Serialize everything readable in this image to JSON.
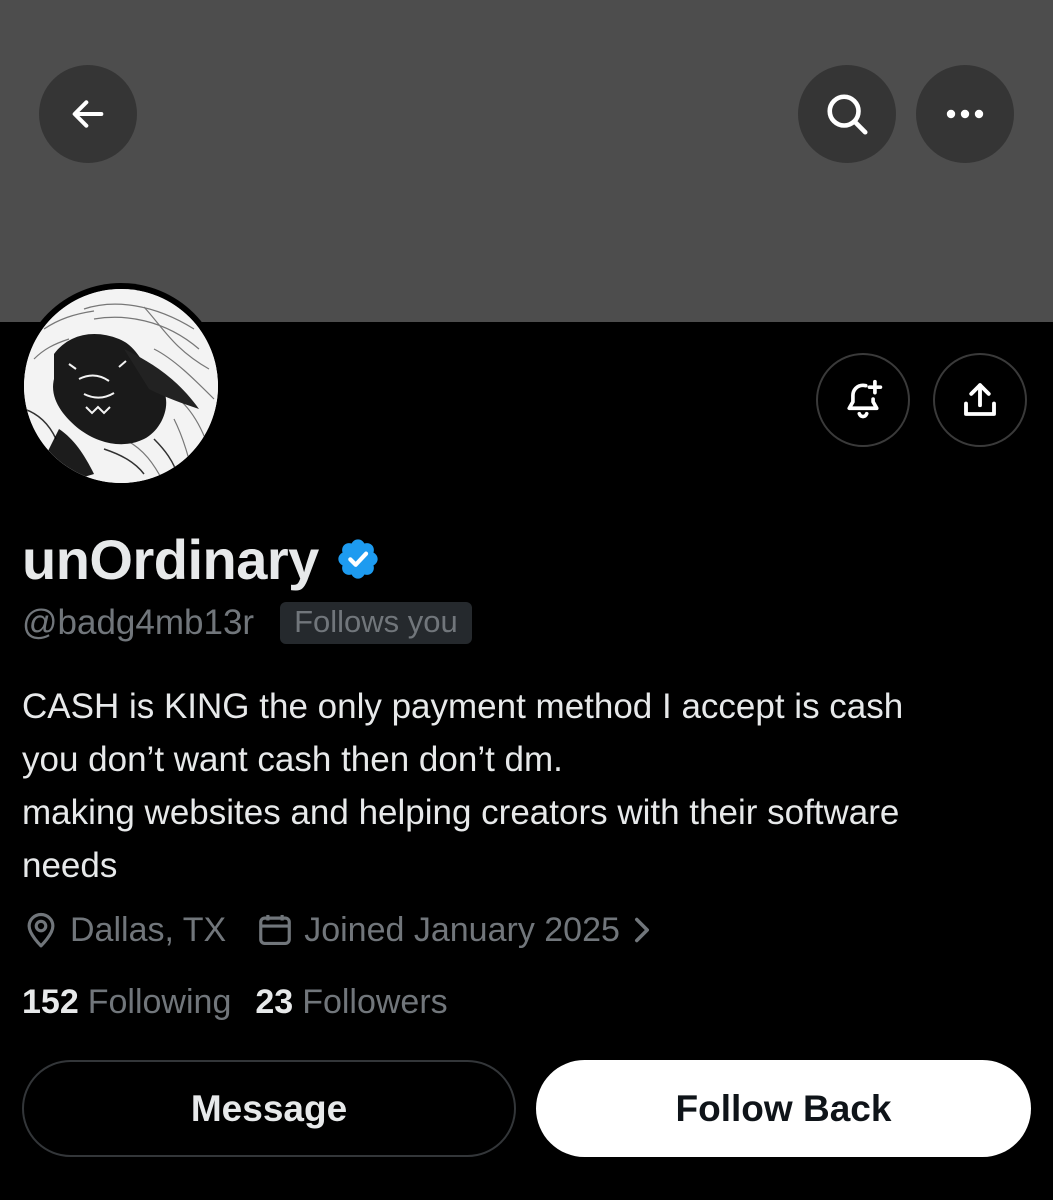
{
  "header": {
    "back_icon": "arrow-left-icon",
    "search_icon": "search-icon",
    "more_icon": "more-horizontal-icon"
  },
  "profile": {
    "display_name": "unOrdinary",
    "verified": true,
    "handle": "@badg4mb13r",
    "follows_you_label": "Follows you",
    "bio_lines": [
      "CASH is KING the only payment method I accept is cash",
      "you don’t want cash then don’t dm.",
      "making websites and helping creators with their software",
      "needs"
    ],
    "location": "Dallas, TX",
    "joined": "Joined January 2025",
    "following_count": "152",
    "following_label": "Following",
    "followers_count": "23",
    "followers_label": "Followers"
  },
  "actions": {
    "notify_icon": "bell-plus-icon",
    "share_icon": "share-icon",
    "message_label": "Message",
    "follow_label": "Follow Back"
  },
  "colors": {
    "banner": "#4d4d4d",
    "background": "#000000",
    "verified_badge": "#1d9bf0",
    "muted_text": "#71767b",
    "primary_text": "#e7e9ea"
  }
}
